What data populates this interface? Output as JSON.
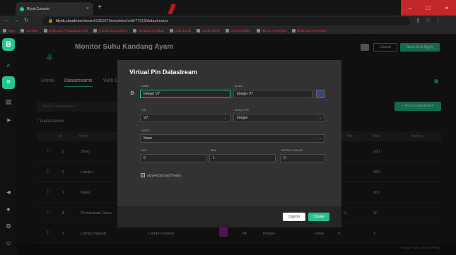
{
  "browser": {
    "tab_title": "Blynk.Console",
    "tab_close": "×",
    "new_tab": "+",
    "url_host": "blynk.cloud",
    "url_path": "/dashboard/125267/templates/edit/77219/datastreams",
    "window_controls": [
      "–",
      "□",
      "×"
    ],
    "bookmarks": [
      "Apps",
      "YouTube",
      "Rekayasa Perangkat Lunak",
      "Protokol Komunikasi",
      "Tampilan Lengkap",
      "Lihat Jurnal",
      "Jurnal Teknik",
      "Jurnal Arduino",
      "Nilai & Perangkat",
      "Rekayasa Perangkat"
    ]
  },
  "sidebar": {
    "logo": "B"
  },
  "header": {
    "title": "Monitor Suhu Kandang Ayam",
    "cancel_label": "Cancel",
    "save_label": "Save And Apply"
  },
  "tabs": {
    "home": "Home",
    "datastreams": "Datastreams",
    "web": "Web Dashboard"
  },
  "toolbar": {
    "search_placeholder": "Search datastreams",
    "new_datastream": "+ New Datastream",
    "count": "7 Datastreams"
  },
  "table": {
    "headers": [
      "Id",
      "Name",
      "Min",
      "Max",
      "Actions"
    ],
    "rows": [
      {
        "id": "5",
        "name": "Suhu",
        "max": "100"
      },
      {
        "id": "6",
        "name": "Lampu",
        "max": "100"
      },
      {
        "id": "7",
        "name": "Kipas",
        "max": "100"
      },
      {
        "id": "8",
        "name": "Pemanasan Suhu",
        "min": "0",
        "max": "10"
      },
      {
        "id": "9",
        "name": "Lampu manual",
        "alias": "Lampu manual",
        "pin": "V4",
        "type": "Integer",
        "units": "False",
        "min": "0",
        "max": "1"
      }
    ]
  },
  "footer": {
    "region": "Region: sgp1  Privacy Policy"
  },
  "modal": {
    "title": "Virtual Pin Datastream",
    "name_label": "NAME",
    "name_value": "Integer V7",
    "alias_label": "ALIAS",
    "alias_value": "Integer V7",
    "pin_label": "PIN",
    "pin_value": "V7",
    "type_label": "DATA TYPE",
    "type_value": "Integer",
    "units_label": "UNITS",
    "units_value": "None",
    "min_label": "MIN",
    "min_value": "0",
    "max_label": "MAX",
    "max_value": "1",
    "default_label": "DEFAULT VALUE",
    "default_value": "0",
    "advanced": "ADVANCED SETTINGS",
    "cancel": "Cancel",
    "create": "Create"
  },
  "colors": {
    "accent": "#23c48e",
    "swatch_row9": "#8b2a8e",
    "swatch_modal": "#3a4680"
  }
}
